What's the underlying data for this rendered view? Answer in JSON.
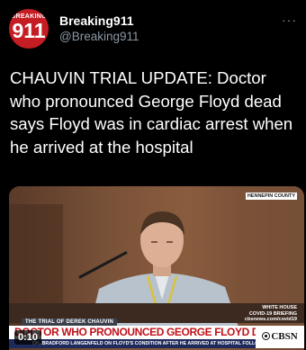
{
  "account": {
    "avatar_top_text": "BREAKING",
    "avatar_number": "911",
    "display_name": "Breaking911",
    "handle": "@Breaking911",
    "more_icon": "more-icon"
  },
  "tweet": {
    "text": "CHAUVIN TRIAL UPDATE: Doctor who pronounced George Floyd dead says Floyd was in cardiac arrest when he arrived at the hospital"
  },
  "video": {
    "timestamp": "0:10",
    "network_logo_top": "HENNEPIN COUNTY",
    "briefing_line1": "WHITE HOUSE",
    "briefing_line2": "COVID-19 BRIEFING",
    "briefing_line3": "cbsnews.com/covid19",
    "lower_third_label": "THE TRIAL OF DEREK CHAUVIN",
    "lower_third_headline": "DOCTOR WHO PRONOUNCED GEORGE FLOYD DEAD TESTIFYING",
    "lower_third_sub": "DR. BRADFORD LANGENFELD ON FLOYD'S CONDITION AFTER HE ARRIVED AT HOSPITAL FOLLOWING HIS ARREST",
    "network_name": "CBSN"
  },
  "colors": {
    "background": "#000000",
    "avatar_red": "#c41e24",
    "handle_gray": "#8b98a5",
    "headline_red": "#c0121a",
    "sub_navy": "#1f2a5c"
  }
}
